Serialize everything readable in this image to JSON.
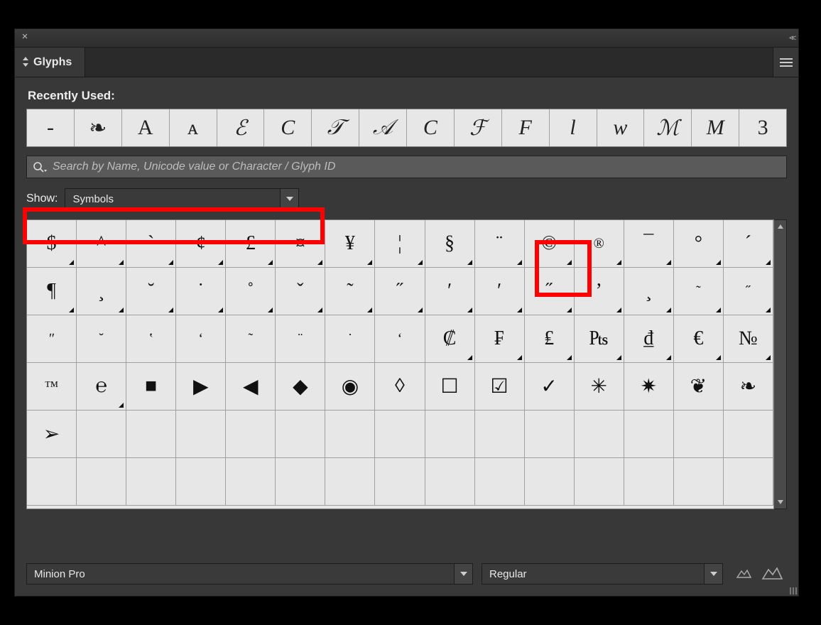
{
  "panel": {
    "title": "Glyphs",
    "recent_label": "Recently Used:",
    "show_label": "Show:",
    "show_value": "Symbols",
    "font_value": "Minion Pro",
    "style_value": "Regular"
  },
  "search": {
    "placeholder": "Search by Name, Unicode value or Character / Glyph ID"
  },
  "recent": [
    {
      "g": "-",
      "cls": "upright"
    },
    {
      "g": "❧",
      "cls": "upright"
    },
    {
      "g": "A",
      "cls": "upright"
    },
    {
      "g": "ᴀ",
      "cls": "upright"
    },
    {
      "g": "ℰ",
      "cls": "script"
    },
    {
      "g": "C",
      "cls": ""
    },
    {
      "g": "𝒯",
      "cls": "script"
    },
    {
      "g": "𝒜",
      "cls": "script"
    },
    {
      "g": "C",
      "cls": ""
    },
    {
      "g": "ℱ",
      "cls": "script"
    },
    {
      "g": "F",
      "cls": ""
    },
    {
      "g": "l",
      "cls": ""
    },
    {
      "g": "w",
      "cls": ""
    },
    {
      "g": "ℳ",
      "cls": "script"
    },
    {
      "g": "M",
      "cls": ""
    },
    {
      "g": "3",
      "cls": "upright"
    }
  ],
  "glyph_rows": [
    [
      {
        "g": "$",
        "t": true
      },
      {
        "g": "^",
        "t": true
      },
      {
        "g": "`",
        "t": true
      },
      {
        "g": "¢",
        "t": true
      },
      {
        "g": "£",
        "t": true
      },
      {
        "g": "¤",
        "t": true
      },
      {
        "g": "¥",
        "t": true
      },
      {
        "g": "¦",
        "t": true
      },
      {
        "g": "§",
        "t": true
      },
      {
        "g": "¨",
        "t": true
      },
      {
        "g": "©",
        "t": true
      },
      {
        "g": "®",
        "t": true,
        "cls": "small"
      },
      {
        "g": "¯",
        "t": true
      },
      {
        "g": "°",
        "t": true
      },
      {
        "g": "´",
        "t": true
      }
    ],
    [
      {
        "g": "¶",
        "t": true
      },
      {
        "g": "¸",
        "t": true
      },
      {
        "g": "˘",
        "t": true
      },
      {
        "g": "˙",
        "t": true
      },
      {
        "g": "˚",
        "t": true
      },
      {
        "g": "ˇ",
        "t": true
      },
      {
        "g": "˜",
        "t": true
      },
      {
        "g": "˝",
        "t": true
      },
      {
        "g": "ʹ",
        "t": true
      },
      {
        "g": "ʹ",
        "t": true
      },
      {
        "g": "˝",
        "t": true
      },
      {
        "g": "ʼ",
        "t": true
      },
      {
        "g": "¸",
        "t": true
      },
      {
        "g": "˜",
        "t": true,
        "cls": "small"
      },
      {
        "g": "˝",
        "t": true,
        "cls": "small"
      }
    ],
    [
      {
        "g": "ʺ",
        "t": false,
        "cls": "small"
      },
      {
        "g": "˘",
        "t": false,
        "cls": "small"
      },
      {
        "g": "ʽ",
        "t": false,
        "cls": "small"
      },
      {
        "g": "ʻ",
        "t": false,
        "cls": "small"
      },
      {
        "g": "˜",
        "t": false,
        "cls": "small"
      },
      {
        "g": "¨",
        "t": false,
        "cls": "small"
      },
      {
        "g": "˙",
        "t": false,
        "cls": "small"
      },
      {
        "g": "ʻ",
        "t": false,
        "cls": "small"
      },
      {
        "g": "₡",
        "t": true
      },
      {
        "g": "₣",
        "t": true
      },
      {
        "g": "₤",
        "t": true
      },
      {
        "g": "₧",
        "t": true
      },
      {
        "g": "₫",
        "t": true
      },
      {
        "g": "€",
        "t": true
      },
      {
        "g": "№",
        "t": true
      }
    ],
    [
      {
        "g": "™",
        "t": false,
        "cls": "small"
      },
      {
        "g": "℮",
        "t": true
      },
      {
        "g": "■",
        "t": false
      },
      {
        "g": "▶",
        "t": false
      },
      {
        "g": "◀",
        "t": false
      },
      {
        "g": "◆",
        "t": false
      },
      {
        "g": "◉",
        "t": false
      },
      {
        "g": "◊",
        "t": false
      },
      {
        "g": "☐",
        "t": false
      },
      {
        "g": "☑",
        "t": false
      },
      {
        "g": "✓",
        "t": false
      },
      {
        "g": "✳",
        "t": false
      },
      {
        "g": "✷",
        "t": false
      },
      {
        "g": "❦",
        "t": false
      },
      {
        "g": "❧",
        "t": false
      }
    ],
    [
      {
        "g": "➢",
        "t": false
      },
      {
        "g": "",
        "t": false
      },
      {
        "g": "",
        "t": false
      },
      {
        "g": "",
        "t": false
      },
      {
        "g": "",
        "t": false
      },
      {
        "g": "",
        "t": false
      },
      {
        "g": "",
        "t": false
      },
      {
        "g": "",
        "t": false
      },
      {
        "g": "",
        "t": false
      },
      {
        "g": "",
        "t": false
      },
      {
        "g": "",
        "t": false
      },
      {
        "g": "",
        "t": false
      },
      {
        "g": "",
        "t": false
      },
      {
        "g": "",
        "t": false
      },
      {
        "g": "",
        "t": false
      }
    ],
    [
      {
        "g": "",
        "t": false
      },
      {
        "g": "",
        "t": false
      },
      {
        "g": "",
        "t": false
      },
      {
        "g": "",
        "t": false
      },
      {
        "g": "",
        "t": false
      },
      {
        "g": "",
        "t": false
      },
      {
        "g": "",
        "t": false
      },
      {
        "g": "",
        "t": false
      },
      {
        "g": "",
        "t": false
      },
      {
        "g": "",
        "t": false
      },
      {
        "g": "",
        "t": false
      },
      {
        "g": "",
        "t": false
      },
      {
        "g": "",
        "t": false
      },
      {
        "g": "",
        "t": false
      },
      {
        "g": "",
        "t": false
      }
    ]
  ]
}
